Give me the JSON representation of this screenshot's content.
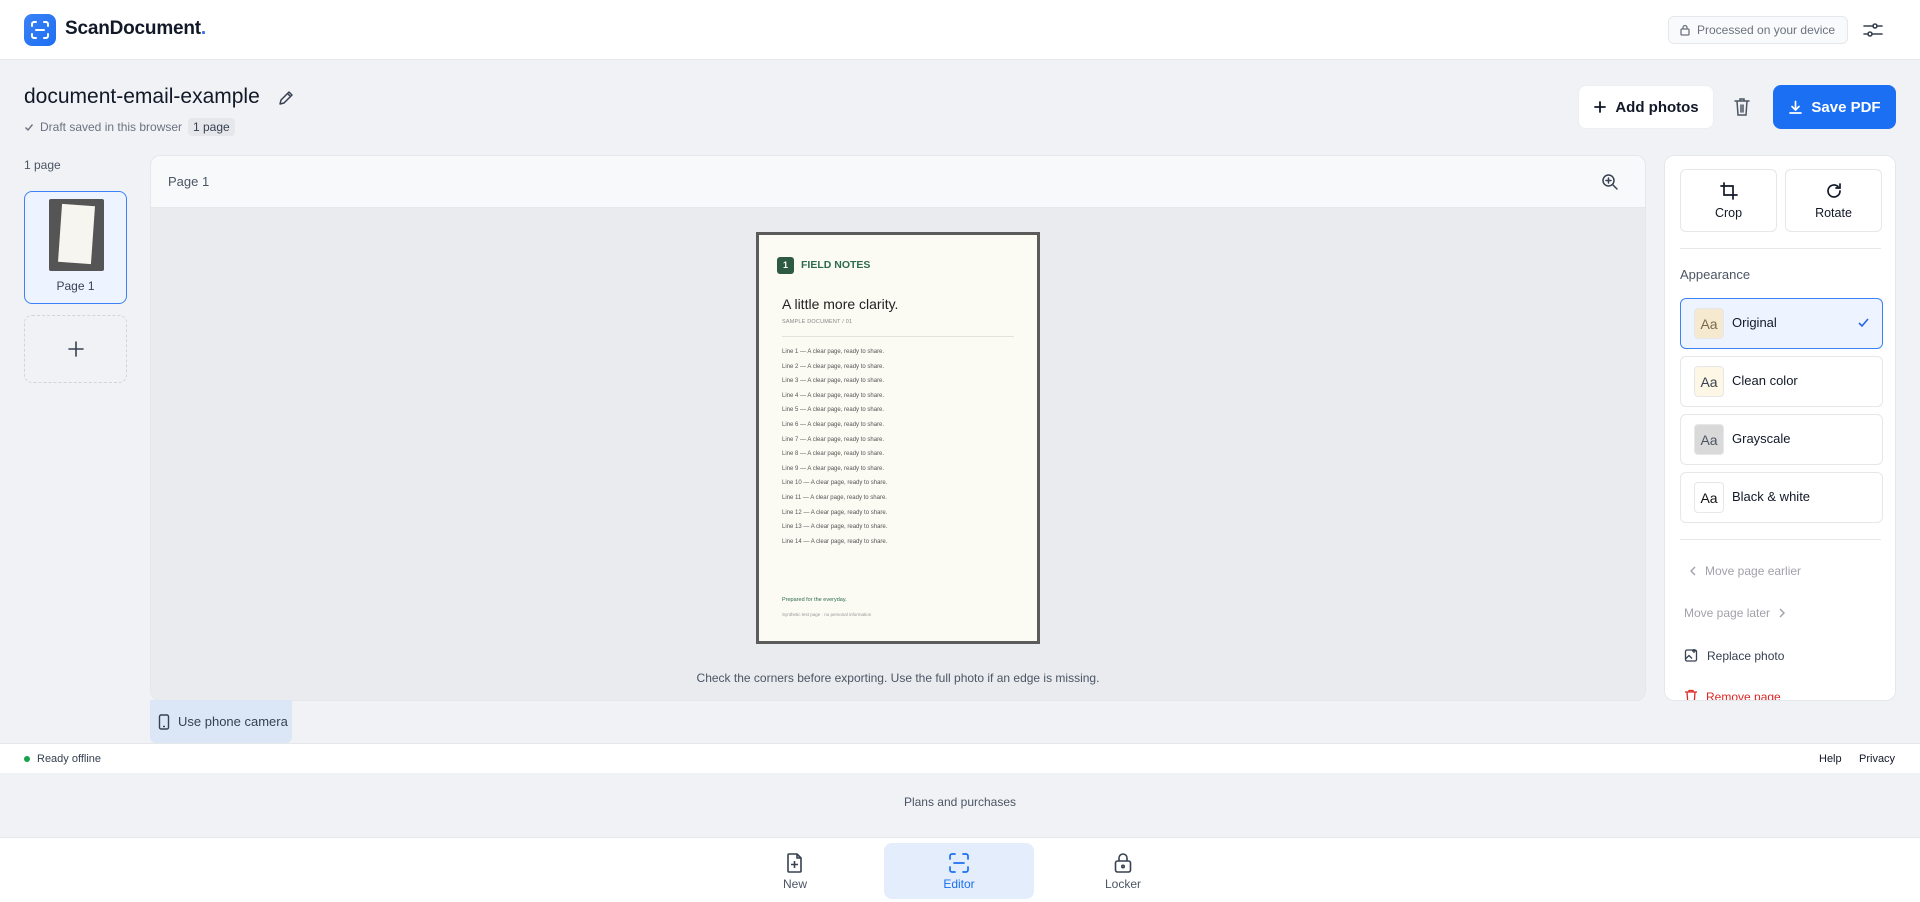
{
  "app": {
    "brand": "ScanDocument",
    "brand_dot": ".",
    "device_status": "Processed on your device"
  },
  "document": {
    "title": "document-email-example",
    "draft_status": "Draft saved in this browser",
    "page_badge": "1 page"
  },
  "toolbar": {
    "add_photos": "Add photos",
    "save_pdf": "Save PDF"
  },
  "sidebar": {
    "page_count": "1 page",
    "pages": [
      {
        "label": "Page 1"
      }
    ]
  },
  "canvas": {
    "title": "Page 1",
    "hint": "Check the corners before exporting. Use the full photo if an edge is missing."
  },
  "preview": {
    "badge": "1",
    "header": "FIELD NOTES",
    "title": "A little more clarity.",
    "subtitle": "SAMPLE DOCUMENT / 01",
    "lines": [
      "Line 1 — A clear page, ready to share.",
      "Line 2 — A clear page, ready to share.",
      "Line 3 — A clear page, ready to share.",
      "Line 4 — A clear page, ready to share.",
      "Line 5 — A clear page, ready to share.",
      "Line 6 — A clear page, ready to share.",
      "Line 7 — A clear page, ready to share.",
      "Line 8 — A clear page, ready to share.",
      "Line 9 — A clear page, ready to share.",
      "Line 10 — A clear page, ready to share.",
      "Line 11 — A clear page, ready to share.",
      "Line 12 — A clear page, ready to share.",
      "Line 13 — A clear page, ready to share.",
      "Line 14 — A clear page, ready to share."
    ],
    "footer1": "Prepared for the everyday.",
    "footer2": "Synthetic test page · no personal information"
  },
  "phone_camera": "Use phone camera",
  "panel": {
    "crop": "Crop",
    "rotate": "Rotate",
    "appearance_heading": "Appearance",
    "options": [
      {
        "swatch": "Aa",
        "label": "Original",
        "selected": true
      },
      {
        "swatch": "Aa",
        "label": "Clean color",
        "selected": false
      },
      {
        "swatch": "Aa",
        "label": "Grayscale",
        "selected": false
      },
      {
        "swatch": "Aa",
        "label": "Black & white",
        "selected": false
      }
    ],
    "move_earlier": "Move page earlier",
    "move_later": "Move page later",
    "replace_photo": "Replace photo",
    "remove_page": "Remove page"
  },
  "status": {
    "ready": "Ready offline",
    "help": "Help",
    "privacy": "Privacy"
  },
  "plans": "Plans and purchases",
  "nav": [
    {
      "label": "New",
      "icon": "new-document-icon"
    },
    {
      "label": "Editor",
      "icon": "scan-icon",
      "active": true
    },
    {
      "label": "Locker",
      "icon": "lock-icon"
    }
  ],
  "colors": {
    "accent": "#1a6ff2",
    "brand_green": "#2e6b4f",
    "danger": "#dc2626",
    "online": "#16a34a"
  }
}
